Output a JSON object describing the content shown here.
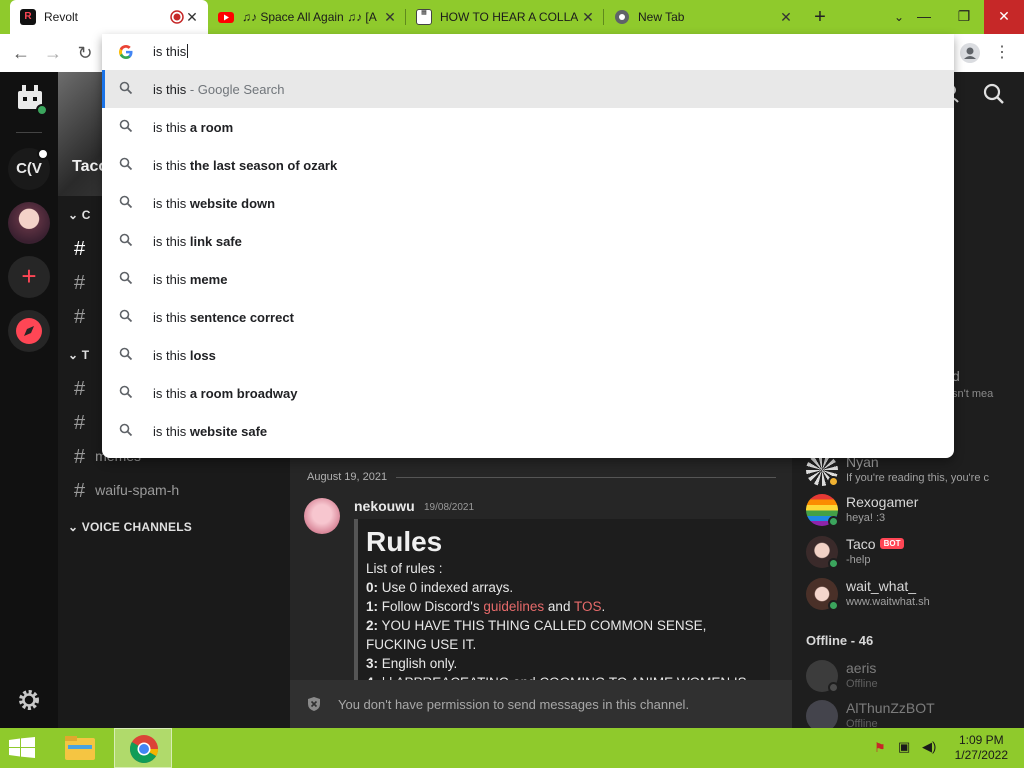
{
  "browser": {
    "tabs": [
      {
        "title": "Revolt",
        "active": true,
        "recording": true
      },
      {
        "title": "♫♪ Space All Again ♫♪ [A",
        "active": false
      },
      {
        "title": "HOW TO HEAR A COLLA",
        "active": false
      },
      {
        "title": "New Tab",
        "active": false
      }
    ],
    "new_tab_symbol": "+",
    "omnibox": {
      "value": "is this",
      "suggestions": [
        {
          "prefix": "is this",
          "bold": "",
          "suffix": " - Google Search"
        },
        {
          "prefix": "is this ",
          "bold": "a room",
          "suffix": ""
        },
        {
          "prefix": "is this ",
          "bold": "the last season of ozark",
          "suffix": ""
        },
        {
          "prefix": "is this ",
          "bold": "website down",
          "suffix": ""
        },
        {
          "prefix": "is this ",
          "bold": "link safe",
          "suffix": ""
        },
        {
          "prefix": "is this ",
          "bold": "meme",
          "suffix": ""
        },
        {
          "prefix": "is this ",
          "bold": "sentence correct",
          "suffix": ""
        },
        {
          "prefix": "is this ",
          "bold": "loss",
          "suffix": ""
        },
        {
          "prefix": "is this ",
          "bold": "a room broadway",
          "suffix": ""
        },
        {
          "prefix": "is this ",
          "bold": "website safe",
          "suffix": ""
        }
      ]
    }
  },
  "revolt": {
    "servers": {
      "cv_label": "C(V"
    },
    "server_name_partial": "Taco",
    "channels": {
      "category_1_partial": "C",
      "category_2_partial": "T",
      "memes": "memes",
      "waifu": "waifu-spam-h",
      "voice_channels": "VOICE CHANNELS"
    },
    "date_divider": "August 19, 2021",
    "message": {
      "author": "nekouwu",
      "timestamp": "19/08/2021",
      "embed_title": "Rules",
      "intro": "List of rules :",
      "rules": [
        {
          "num": "0:",
          "text": " Use 0 indexed arrays."
        },
        {
          "num": "1:",
          "text_before": " Follow Discord's ",
          "link1": "guidelines",
          "mid": " and ",
          "link2": "TOS",
          "after": "."
        },
        {
          "num": "2:",
          "text": " YOU HAVE THIS THING CALLED COMMON SENSE, FUCKING USE IT."
        },
        {
          "num": "3:",
          "text": " English only."
        },
        {
          "num": "4:",
          "text": " | | APPREACEATING and COOMING TO ANIME WOMEN IS"
        }
      ]
    },
    "no_permission": "You don't have permission to send messages in this channel.",
    "members": {
      "partial_top_name": "d",
      "partial_top_status": "sn't mea",
      "online": [
        {
          "name": "Nyan",
          "status": "If you're reading this, you're c",
          "dot": "#f0b232"
        },
        {
          "name": "Rexogamer",
          "status": "heya! :3",
          "dot": "#3ba55d"
        },
        {
          "name": "Taco",
          "status": "-help",
          "dot": "#3ba55d",
          "badge": "BOT"
        },
        {
          "name": "wait_what_",
          "status": "www.waitwhat.sh",
          "dot": "#3ba55d"
        }
      ],
      "offline_header": "Offline - 46",
      "offline": [
        {
          "name": "aeris",
          "status": "Offline"
        },
        {
          "name": "AlThunZzBOT",
          "status": "Offline"
        }
      ]
    }
  },
  "taskbar": {
    "time": "1:09 PM",
    "date": "1/27/2022"
  },
  "colors": {
    "accent_green": "#8fca2c",
    "revolt_red": "#ff4655",
    "link_red": "#e66a6a"
  }
}
